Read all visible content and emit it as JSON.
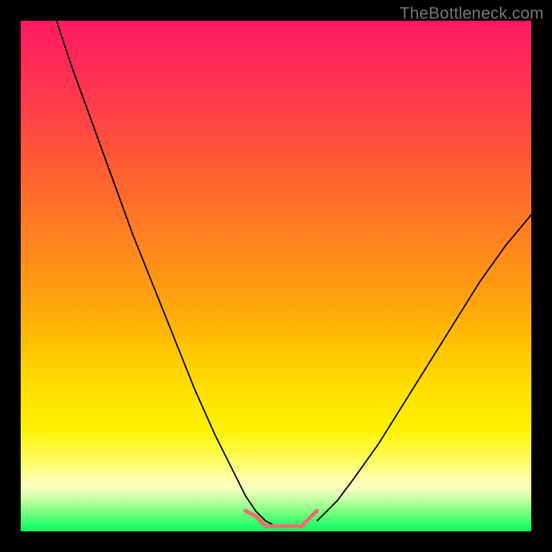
{
  "watermark": {
    "text": "TheBottleneck.com"
  },
  "chart_data": {
    "type": "line",
    "title": "",
    "xlabel": "",
    "ylabel": "",
    "xlim": [
      0,
      100
    ],
    "ylim": [
      0,
      100
    ],
    "grid": false,
    "legend": false,
    "background_gradient": {
      "orientation": "vertical",
      "stops": [
        {
          "pct": 0,
          "color": "#ff1a62"
        },
        {
          "pct": 18,
          "color": "#ff4048"
        },
        {
          "pct": 42,
          "color": "#ff8020"
        },
        {
          "pct": 63,
          "color": "#ffc000"
        },
        {
          "pct": 80,
          "color": "#fff200"
        },
        {
          "pct": 91,
          "color": "#ffffc0"
        },
        {
          "pct": 97,
          "color": "#60ff78"
        },
        {
          "pct": 100,
          "color": "#00ff66"
        }
      ]
    },
    "series": [
      {
        "name": "left-branch",
        "stroke": "#000000",
        "stroke_width": 2,
        "x": [
          7,
          10,
          14,
          18,
          22,
          26,
          30,
          34,
          38,
          42,
          44,
          46,
          48,
          50
        ],
        "y": [
          100,
          91,
          80,
          69,
          58,
          48,
          38,
          28,
          19,
          11,
          7,
          4,
          2,
          1
        ]
      },
      {
        "name": "right-branch",
        "stroke": "#000000",
        "stroke_width": 2,
        "x": [
          58,
          60,
          62,
          65,
          70,
          75,
          80,
          85,
          90,
          95,
          100
        ],
        "y": [
          2,
          4,
          6,
          10,
          17,
          25,
          33,
          41,
          49,
          56,
          62
        ]
      },
      {
        "name": "floor-markers",
        "stroke": "#e97070",
        "stroke_width": 6,
        "marker": "round",
        "x": [
          44,
          46,
          47,
          48,
          50,
          52,
          54,
          55,
          56,
          57,
          58
        ],
        "y": [
          4,
          3,
          2,
          1,
          1,
          1,
          1,
          1,
          2,
          3,
          4
        ]
      }
    ],
    "annotations": []
  }
}
